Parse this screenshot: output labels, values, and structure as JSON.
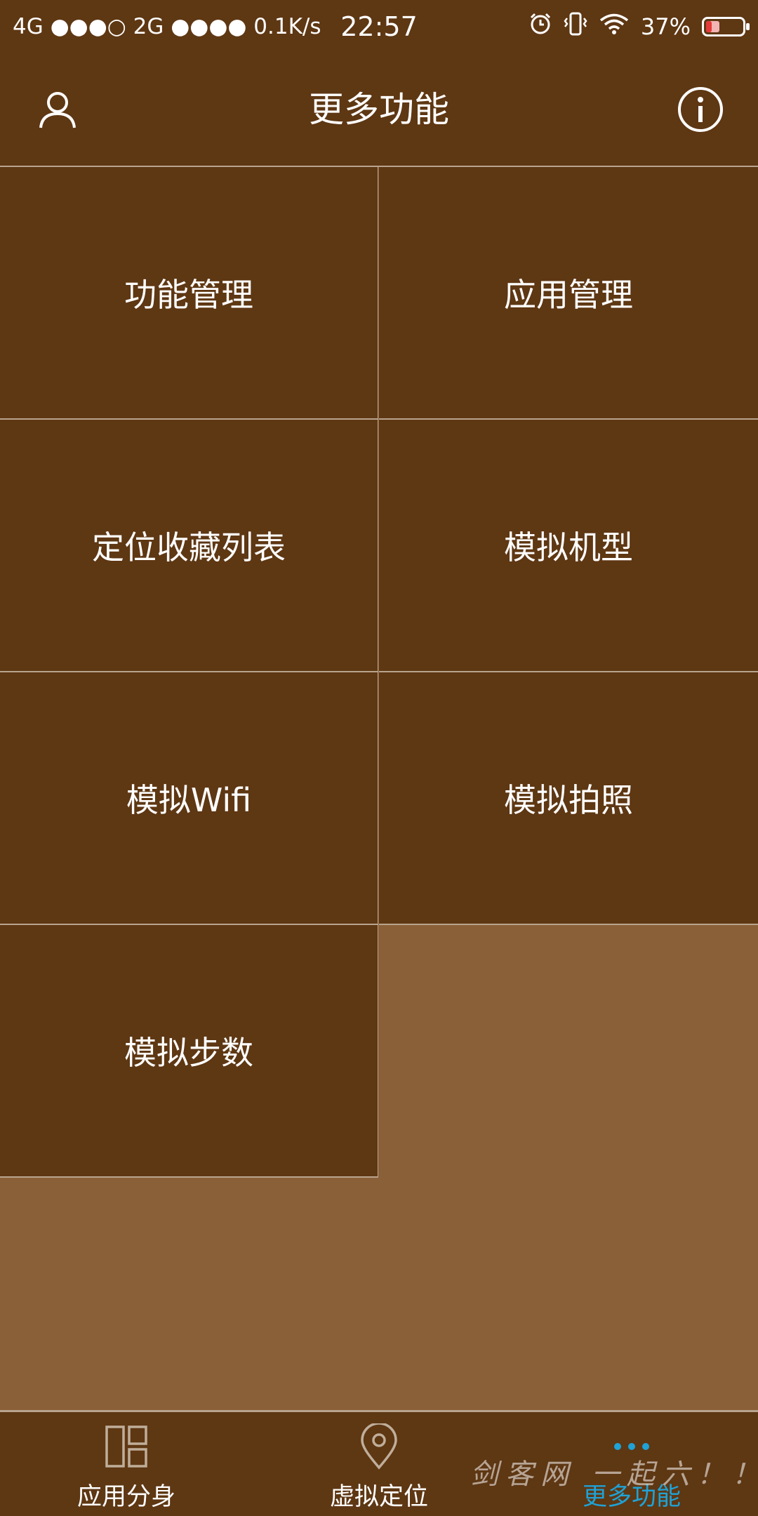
{
  "status_bar": {
    "network": "4G ●●●○ 2G ●●●● 0.1K/s",
    "time": "22:57",
    "battery_percent": "37%",
    "battery_level": 0.37
  },
  "header": {
    "title": "更多功能",
    "left_icon": "user-icon",
    "right_icon": "info-icon"
  },
  "tiles": [
    {
      "label": "功能管理"
    },
    {
      "label": "应用管理"
    },
    {
      "label": "定位收藏列表"
    },
    {
      "label": "模拟机型"
    },
    {
      "label": "模拟Wifi"
    },
    {
      "label": "模拟拍照"
    },
    {
      "label": "模拟步数"
    }
  ],
  "bottom_nav": {
    "items": [
      {
        "label": "应用分身",
        "icon": "app-clone-icon"
      },
      {
        "label": "虚拟定位",
        "icon": "location-pin-icon"
      },
      {
        "label": "更多功能",
        "icon": "more-dots-icon",
        "active": true
      }
    ]
  },
  "watermark": "剑客网 一起六！！",
  "colors": {
    "bar_bg": "#5e3713",
    "page_bg": "#8a6039",
    "divider": "#b9a48e",
    "active": "#1fa2d6"
  }
}
